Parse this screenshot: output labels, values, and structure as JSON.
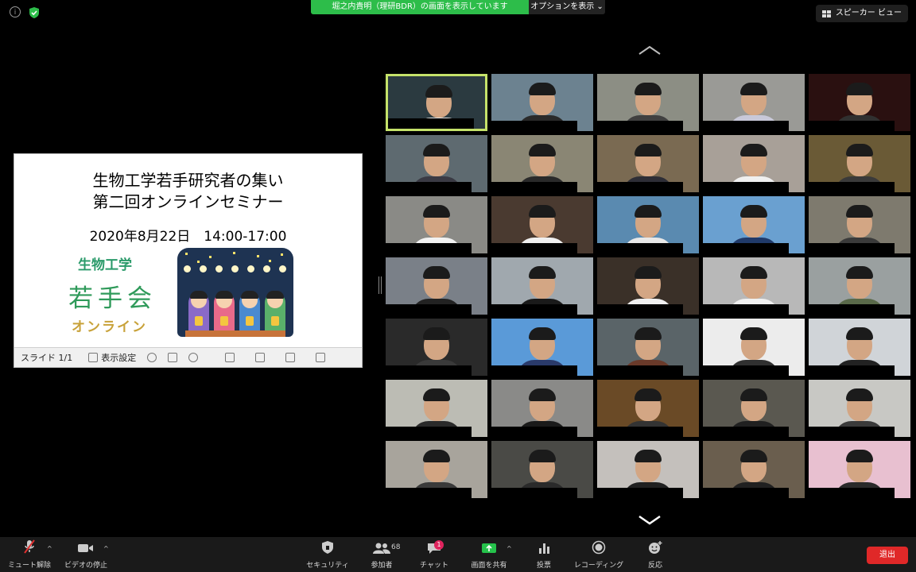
{
  "top": {
    "share_banner": "堀之内貴明（理研BDR）の画面を表示しています",
    "options_label": "オプションを表示 ⌄",
    "view_label": "スピーカー ビュー",
    "icons": [
      "info-icon",
      "encryption-shield-icon"
    ]
  },
  "slide": {
    "title_line1": "生物工学若手研究者の集い",
    "title_line2": "第二回オンラインセミナー",
    "date": "2020年8月22日　14:00-17:00",
    "logo_line1": "生物工学",
    "logo_line2": "若手会",
    "logo_line3": "オンライン",
    "toolbar_slide": "スライド 1/1",
    "toolbar_display": "表示設定"
  },
  "gallery": {
    "rows": 7,
    "cols": 5,
    "active_index": 0,
    "tiles": [
      {
        "bg": "#2b3a40",
        "shirt": "#e8e8e8"
      },
      {
        "bg": "#6c8290",
        "shirt": "#2a2a2a"
      },
      {
        "bg": "#8c8e84",
        "shirt": "#404040"
      },
      {
        "bg": "#9a9a96",
        "shirt": "#c8c8d8"
      },
      {
        "bg": "#2a1010",
        "shirt": "#303030"
      },
      {
        "bg": "#5e6a70",
        "shirt": "#3a3a44"
      },
      {
        "bg": "#8a8674",
        "shirt": "#2a2a2a"
      },
      {
        "bg": "#7a6a52",
        "shirt": "#2e2e36"
      },
      {
        "bg": "#a8a098",
        "shirt": "#f0f0f0"
      },
      {
        "bg": "#6a5a36",
        "shirt": "#3a3a3a"
      },
      {
        "bg": "#8a8a86",
        "shirt": "#f2f2f2"
      },
      {
        "bg": "#4a3a30",
        "shirt": "#f0f0f0"
      },
      {
        "bg": "#5a8ab0",
        "shirt": "#e8e8e8"
      },
      {
        "bg": "#6aa0d0",
        "shirt": "#203a6a"
      },
      {
        "bg": "#7e7a6e",
        "shirt": "#3a3a3a"
      },
      {
        "bg": "#7a8088",
        "shirt": "#222222"
      },
      {
        "bg": "#a0a8ae",
        "shirt": "#1a1a1a"
      },
      {
        "bg": "#3a3028",
        "shirt": "#f0f0f0"
      },
      {
        "bg": "#b8b8b8",
        "shirt": "#f0f0f0"
      },
      {
        "bg": "#9aa0a0",
        "shirt": "#5a6a4a"
      },
      {
        "bg": "#2a2a2a",
        "shirt": "#3a3a3a"
      },
      {
        "bg": "#5a9ad8",
        "shirt": "#2a3a6a"
      },
      {
        "bg": "#5a6468",
        "shirt": "#6a3a2a"
      },
      {
        "bg": "#ececec",
        "shirt": "#303030"
      },
      {
        "bg": "#d0d4d8",
        "shirt": "#222222"
      },
      {
        "bg": "#bcbcb4",
        "shirt": "#2a2a2a"
      },
      {
        "bg": "#8a8a88",
        "shirt": "#1a1a1a"
      },
      {
        "bg": "#6a4a26",
        "shirt": "#333333"
      },
      {
        "bg": "#5a5850",
        "shirt": "#202020"
      },
      {
        "bg": "#c8c8c4",
        "shirt": "#3a3a3a"
      },
      {
        "bg": "#a8a49c",
        "shirt": "#3a3a3a"
      },
      {
        "bg": "#4a4a46",
        "shirt": "#2a2a2a"
      },
      {
        "bg": "#c4c0bc",
        "shirt": "#202020"
      },
      {
        "bg": "#6a5e4e",
        "shirt": "#202020"
      },
      {
        "bg": "#e8c0d0",
        "shirt": "#2a2a2a"
      }
    ]
  },
  "toolbar": {
    "mute": "ミュート解除",
    "video": "ビデオの停止",
    "security": "セキュリティ",
    "participants": "参加者",
    "participants_count": "68",
    "chat": "チャット",
    "chat_badge": "1",
    "share": "画面を共有",
    "poll": "投票",
    "record": "レコーディング",
    "reactions": "反応",
    "leave": "退出",
    "colors": {
      "share_green": "#25c24b",
      "leave_red": "#e02828"
    }
  }
}
